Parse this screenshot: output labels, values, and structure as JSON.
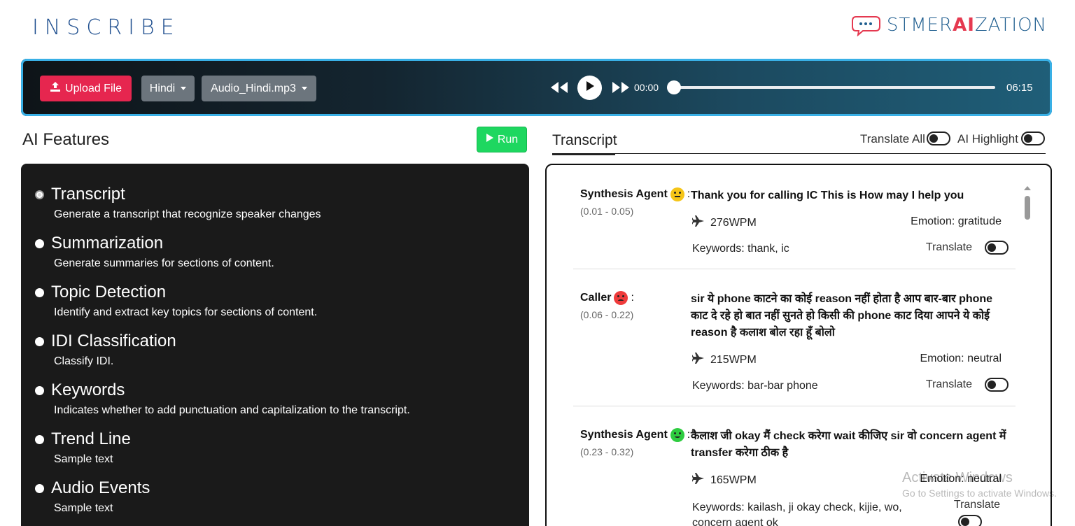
{
  "header": {
    "brand": "INSCRIBE",
    "brand_right_pre": "STMER",
    "brand_right_ai": "AI",
    "brand_right_post": "ZATION"
  },
  "player": {
    "upload_label": "Upload File",
    "language": "Hindi",
    "file": "Audio_Hindi.mp3",
    "current_time": "00:00",
    "end_time": "06:15",
    "progress": 0
  },
  "features": {
    "title": "AI Features",
    "run_label": "Run",
    "items": [
      {
        "name": "Transcript",
        "desc": "Generate a transcript that recognize speaker changes",
        "selected": true
      },
      {
        "name": "Summarization",
        "desc": "Generate summaries for sections of content.",
        "selected": false
      },
      {
        "name": "Topic Detection",
        "desc": "Identify and extract key topics for sections of content.",
        "selected": false
      },
      {
        "name": "IDI Classification",
        "desc": "Classify IDI.",
        "selected": false
      },
      {
        "name": "Keywords",
        "desc": "Indicates whether to add punctuation and capitalization to the transcript.",
        "selected": false
      },
      {
        "name": "Trend Line",
        "desc": "Sample text",
        "selected": false
      },
      {
        "name": "Audio Events",
        "desc": "Sample text",
        "selected": false
      }
    ]
  },
  "transcript": {
    "tab_label": "Transcript",
    "translate_all_label": "Translate All",
    "ai_highlight_label": "AI Highlight",
    "entries": [
      {
        "speaker": "Synthesis Agent",
        "sentiment": "neutral",
        "range": "(0.01 - 0.05)",
        "text": "Thank you for calling IC This is How may I help you",
        "wpm": "276",
        "wpm_unit": "WPM",
        "emotion": "Emotion: gratitude",
        "keywords": "Keywords: thank, ic",
        "translate_label": "Translate"
      },
      {
        "speaker": "Caller",
        "sentiment": "sad",
        "range": "(0.06 - 0.22)",
        "text": "sir ये phone काटने का कोई reason नहीं होता है आप बार-बार phone काट दे रहे हो बात नहीं सुनते हो किसी की phone काट दिया आपने ये कोई reason है कलाश बोल रहा हूँ बोलो",
        "wpm": "215",
        "wpm_unit": "WPM",
        "emotion": "Emotion: neutral",
        "keywords": "Keywords: bar-bar phone",
        "translate_label": "Translate"
      },
      {
        "speaker": "Synthesis Agent",
        "sentiment": "happy",
        "range": "(0.23 - 0.32)",
        "text": "कैलाश जी okay मैं check करेगा wait कीजिए sir वो concern agent में transfer करेगा ठीक है",
        "wpm": "165",
        "wpm_unit": "WPM",
        "emotion": "Emotion: neutral",
        "keywords": "Keywords: kailash, ji okay check, kijie, wo, concern agent ok",
        "translate_label": "Translate"
      }
    ]
  },
  "watermark": {
    "line1": "Activate Windows",
    "line2": "Go to Settings to activate Windows."
  }
}
